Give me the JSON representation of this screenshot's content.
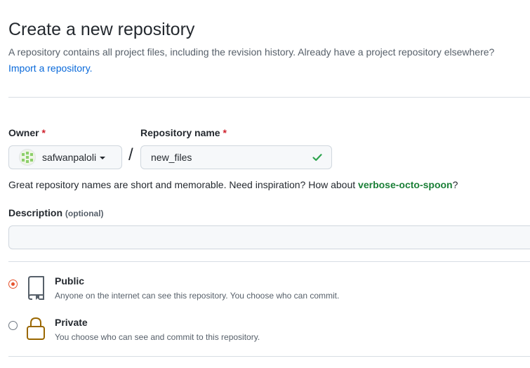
{
  "header": {
    "title": "Create a new repository",
    "subtitle": "A repository contains all project files, including the revision history. Already have a project repository elsewhere?",
    "import_link": "Import a repository."
  },
  "owner": {
    "label": "Owner",
    "required_marker": "*",
    "value": "safwanpaloli",
    "avatar_icon": "identicon-avatar",
    "dropdown_icon": "caret-down-icon"
  },
  "separator": "/",
  "repo_name": {
    "label": "Repository name",
    "required_marker": "*",
    "value": "new_files",
    "valid_icon": "check-icon",
    "valid_color": "#2da44e"
  },
  "hint": {
    "text": "Great repository names are short and memorable. Need inspiration? How about ",
    "suggestion": "verbose-octo-spoon",
    "suffix": "?"
  },
  "description": {
    "label": "Description",
    "optional_label": "(optional)",
    "value": ""
  },
  "visibility": {
    "options": [
      {
        "title": "Public",
        "description": "Anyone on the internet can see this repository. You choose who can commit.",
        "icon": "repo-icon",
        "selected": true
      },
      {
        "title": "Private",
        "description": "You choose who can see and commit to this repository.",
        "icon": "lock-icon",
        "selected": false
      }
    ]
  },
  "colors": {
    "accent_link": "#0969da",
    "required": "#cf222e",
    "suggestion": "#1a7f37",
    "radio_selected": "#e5532d",
    "lock_icon": "#9a6700"
  }
}
